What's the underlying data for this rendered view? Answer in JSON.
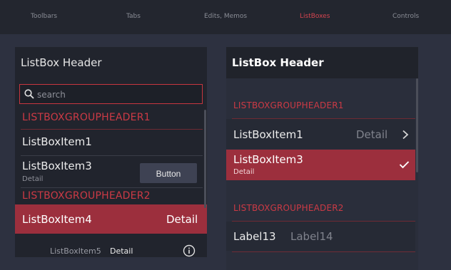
{
  "nav": {
    "tabs": [
      {
        "label": "Toolbars"
      },
      {
        "label": "Tabs"
      },
      {
        "label": "Edits, Memos"
      },
      {
        "label": "ListBoxes"
      },
      {
        "label": "Controls"
      }
    ],
    "active_tab": "ListBoxes"
  },
  "left": {
    "header": "ListBox Header",
    "search": {
      "placeholder": "search",
      "icon": "search-icon"
    },
    "group1": "LISTBOXGROUPHEADER1",
    "item1": "ListBoxItem1",
    "item3": {
      "label": "ListBoxItem3",
      "detail": "Detail",
      "button": "Button"
    },
    "group2": "LISTBOXGROUPHEADER2",
    "item4": {
      "label": "ListBoxItem4",
      "detail": "Detail"
    },
    "item5": {
      "label": "ListBoxItem5",
      "detail": "Detail",
      "icon": "info-icon"
    }
  },
  "right": {
    "header": "ListBox Header",
    "group1": "LISTBOXGROUPHEADER1",
    "item1": {
      "label": "ListBoxItem1",
      "detail": "Detail",
      "icon": "chevron-right-icon"
    },
    "item3": {
      "label": "ListBoxItem3",
      "detail": "Detail",
      "icon": "checkmark-icon"
    },
    "group2": "LISTBOXGROUPHEADER2",
    "labels": {
      "label13": "Label13",
      "label14": "Label14"
    }
  },
  "colors": {
    "accent": "#cc3a45",
    "selected_row": "#9c2f3d",
    "background": "#2d3140",
    "panel": "#21242d"
  }
}
